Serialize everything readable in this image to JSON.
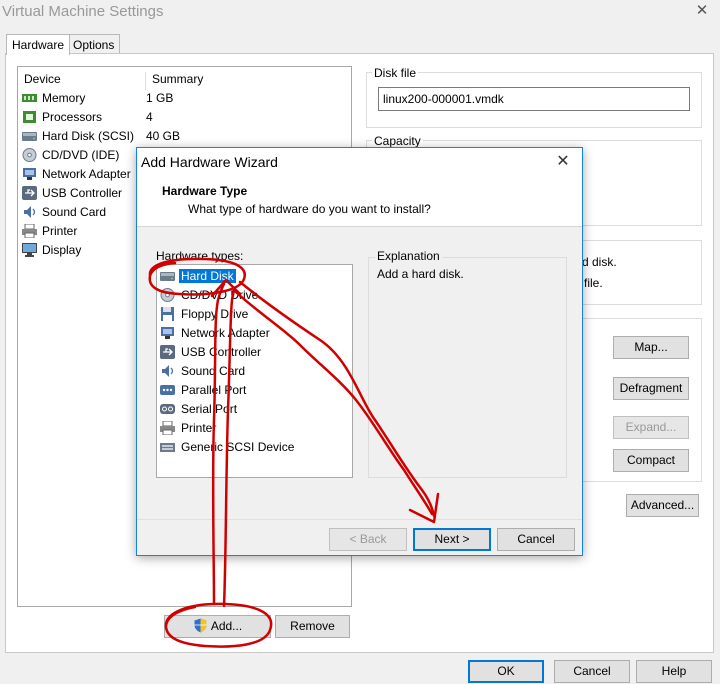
{
  "window": {
    "title": "Virtual Machine Settings",
    "close_glyph": "✕"
  },
  "tabs": [
    {
      "label": "Hardware",
      "active": true
    },
    {
      "label": "Options",
      "active": false
    }
  ],
  "device_list": {
    "columns": {
      "device": "Device",
      "summary": "Summary"
    },
    "rows": [
      {
        "name": "Memory",
        "summary": "1 GB",
        "icon": "memory-icon"
      },
      {
        "name": "Processors",
        "summary": "4",
        "icon": "processor-icon"
      },
      {
        "name": "Hard Disk (SCSI)",
        "summary": "40 GB",
        "icon": "hard-disk-icon"
      },
      {
        "name": "CD/DVD (IDE)",
        "summary": "",
        "icon": "cd-dvd-icon"
      },
      {
        "name": "Network Adapter",
        "summary": "",
        "icon": "network-adapter-icon"
      },
      {
        "name": "USB Controller",
        "summary": "",
        "icon": "usb-icon"
      },
      {
        "name": "Sound Card",
        "summary": "",
        "icon": "sound-card-icon"
      },
      {
        "name": "Printer",
        "summary": "",
        "icon": "printer-icon"
      },
      {
        "name": "Display",
        "summary": "",
        "icon": "display-icon"
      }
    ],
    "add_label": "Add...",
    "remove_label": "Remove"
  },
  "right_panel": {
    "disk_file_label": "Disk file",
    "disk_file_value": "linux200-000001.vmdk",
    "capacity_label": "Capacity",
    "partial_text_1": "rd disk.",
    "partial_text_2": "file.",
    "map_label": "Map...",
    "defragment_label": "Defragment",
    "expand_label": "Expand...",
    "compact_label": "Compact",
    "advanced_label": "Advanced..."
  },
  "footer": {
    "ok_label": "OK",
    "cancel_label": "Cancel",
    "help_label": "Help"
  },
  "wizard": {
    "title": "Add Hardware Wizard",
    "close_glyph": "✕",
    "heading": "Hardware Type",
    "subheading": "What type of hardware do you want to install?",
    "types_label": "Hardware types:",
    "types": [
      {
        "name": "Hard Disk",
        "icon": "hard-disk-icon",
        "selected": true
      },
      {
        "name": "CD/DVD Drive",
        "icon": "cd-dvd-icon",
        "selected": false
      },
      {
        "name": "Floppy Drive",
        "icon": "floppy-icon",
        "selected": false
      },
      {
        "name": "Network Adapter",
        "icon": "network-adapter-icon",
        "selected": false
      },
      {
        "name": "USB Controller",
        "icon": "usb-icon",
        "selected": false
      },
      {
        "name": "Sound Card",
        "icon": "sound-card-icon",
        "selected": false
      },
      {
        "name": "Parallel Port",
        "icon": "parallel-port-icon",
        "selected": false
      },
      {
        "name": "Serial Port",
        "icon": "serial-port-icon",
        "selected": false
      },
      {
        "name": "Printer",
        "icon": "printer-icon",
        "selected": false
      },
      {
        "name": "Generic SCSI Device",
        "icon": "scsi-device-icon",
        "selected": false
      }
    ],
    "explanation_label": "Explanation",
    "explanation_text": "Add a hard disk.",
    "back_label": "< Back",
    "next_label": "Next >",
    "cancel_label": "Cancel"
  },
  "colors": {
    "selection": "#0078d7",
    "annotation": "#d00000"
  }
}
